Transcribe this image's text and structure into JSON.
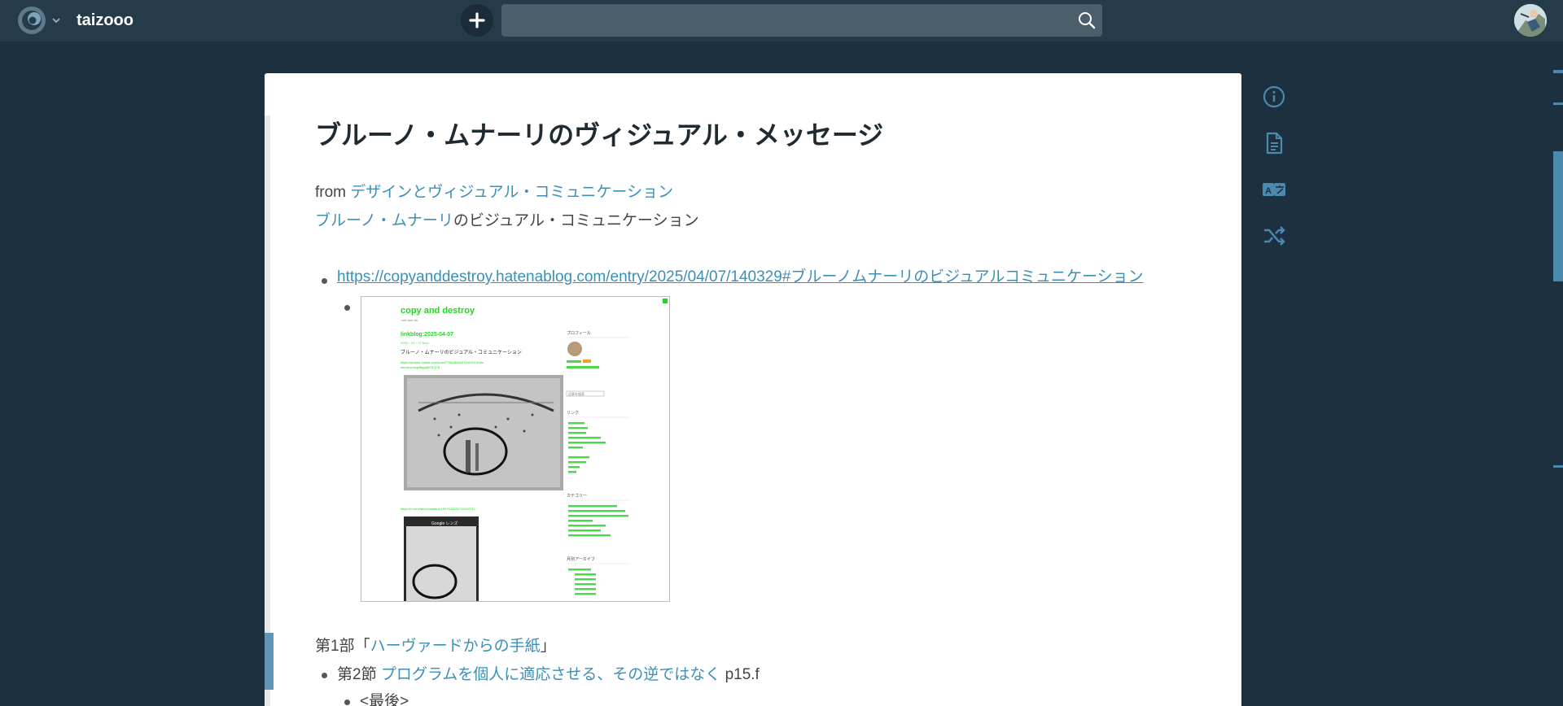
{
  "topbar": {
    "project_name": "taizooo",
    "search_placeholder": "",
    "logo_icon": "scrapbox-logo-icon",
    "colors": {
      "bar": "#263b4a",
      "background": "#1c3040",
      "accent": "#3b8fb6"
    }
  },
  "page": {
    "title": "ブルーノ・ムナーリのヴィジュアル・メッセージ",
    "from_prefix": "from ",
    "from_link": "デザインとヴィジュアル・コミュニケーション",
    "line2_link": "ブルーノ・ムナーリ",
    "line2_text": "のビジュアル・コミュニケーション",
    "url": "https://copyanddestroy.hatenablog.com/entry/2025/04/07/140329#ブルーノムナーリのビジュアルコミュニケーション",
    "thumbnail": {
      "blog_title": "copy and destroy",
      "blog_sub": "-self and all-",
      "post_date_title": "linkblog:2025-04-07",
      "post_meta": "2025・04・07 Mon",
      "post_heading": "ブルーノ・ムナーリのビジュアル・コミュニケーション",
      "post_link1": "https://andree.tumblr.com/post/778628582871407616/visi",
      "post_link1b": "sauvies/negalliggaj078 178",
      "post_link2": "https://x.com/taizooo/status/1907433430719422711",
      "side_profile": "プロフィール",
      "side_search": "記事を検索",
      "side_links": "リンク",
      "side_category": "カテゴリー",
      "side_archive": "月別アーカイブ",
      "phone_title": "Google レンズ"
    },
    "part_prefix": "第1部「",
    "part_link": "ハーヴァードからの手紙",
    "part_suffix": "」",
    "section_prefix": "第2節 ",
    "section_link": "プログラムを個人に適応させる、その逆ではなく",
    "section_suffix": " p15.f",
    "sub_item": "<最後>"
  },
  "toolbar": {
    "icons": [
      "info-icon",
      "page-icon",
      "translate-icon",
      "shuffle-icon"
    ]
  }
}
